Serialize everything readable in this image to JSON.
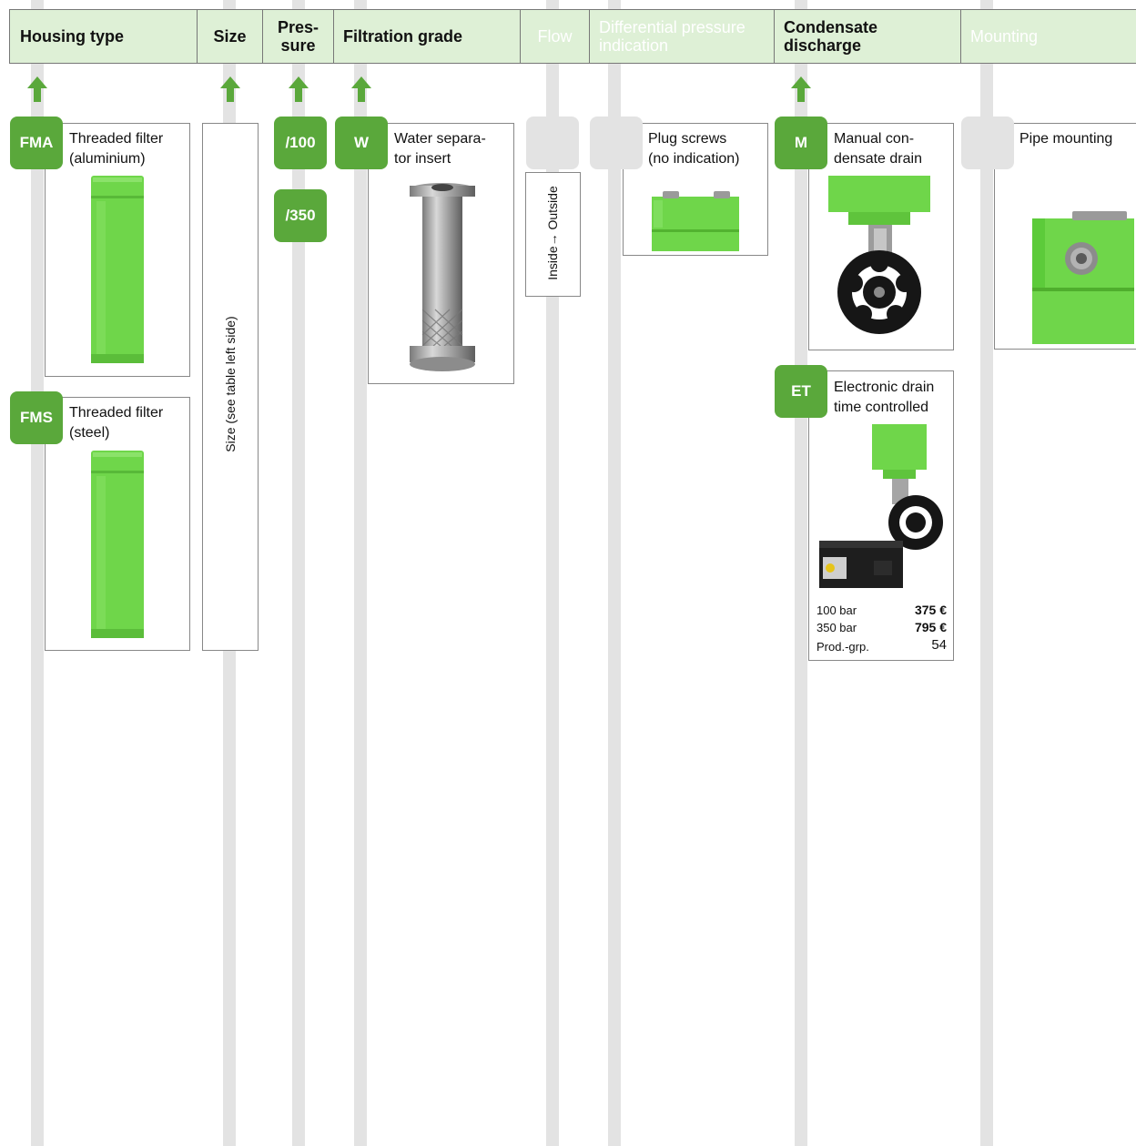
{
  "header": {
    "housing_type": "Housing type",
    "size": "Size",
    "pressure_line1": "Pres-",
    "pressure_line2": "sure",
    "filtration_grade": "Filtration grade",
    "flow": "Flow",
    "diff_line1": "Differential pressure",
    "diff_line2": "indication",
    "condensate_line1": "Condensate",
    "condensate_line2": "discharge",
    "mounting": "Mounting"
  },
  "housing": [
    {
      "code": "FMA",
      "line1": "Threaded filter",
      "line2": "(aluminium)"
    },
    {
      "code": "FMS",
      "line1": "Threaded filter",
      "line2": "(steel)"
    }
  ],
  "size": {
    "label": "Size (see table left side)"
  },
  "pressure": [
    {
      "code": "/100"
    },
    {
      "code": "/350"
    }
  ],
  "filtration": {
    "code": "W",
    "line1": "Water separa-",
    "line2": "tor insert"
  },
  "flow": {
    "label": "Inside→ Outside"
  },
  "diff_pressure": {
    "line1": "Plug screws",
    "line2": "(no indication)"
  },
  "condensate": [
    {
      "code": "M",
      "line1": "Manual con-",
      "line2": "densate drain"
    },
    {
      "code": "ET",
      "line1": "Electronic drain",
      "line2": "time controlled",
      "prices": [
        {
          "label": "100 bar",
          "value": "375 €"
        },
        {
          "label": "350 bar",
          "value": "795 €"
        },
        {
          "label": "Prod.-grp.",
          "value": "54"
        }
      ]
    }
  ],
  "mounting": {
    "label": "Pipe mounting"
  },
  "colors": {
    "accent": "#5aa83b",
    "header_bg": "#def0d6",
    "rail": "#e3e3e3",
    "product": "#6fd64a"
  }
}
